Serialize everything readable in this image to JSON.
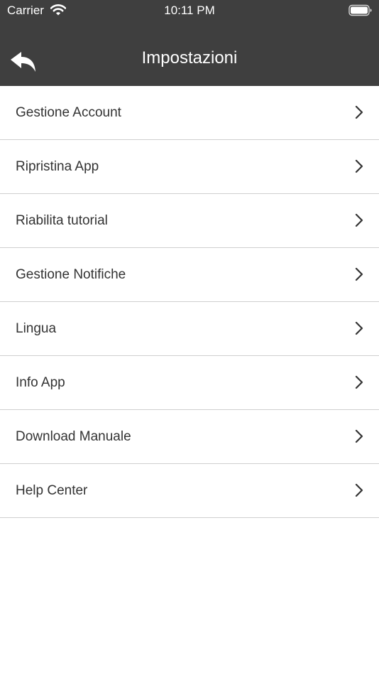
{
  "status_bar": {
    "carrier": "Carrier",
    "time": "10:11 PM",
    "wifi_icon": "wifi-icon",
    "battery_icon": "battery-full-icon"
  },
  "header": {
    "title": "Impostazioni",
    "back_icon": "back-arrow-icon",
    "background_color": "#3f3f3f",
    "text_color": "#ffffff"
  },
  "settings": {
    "items": [
      {
        "label": "Gestione Account"
      },
      {
        "label": "Ripristina App"
      },
      {
        "label": "Riabilita tutorial"
      },
      {
        "label": "Gestione Notifiche"
      },
      {
        "label": "Lingua"
      },
      {
        "label": "Info App"
      },
      {
        "label": "Download Manuale"
      },
      {
        "label": "Help Center"
      }
    ],
    "chevron_icon": "chevron-right-icon"
  }
}
